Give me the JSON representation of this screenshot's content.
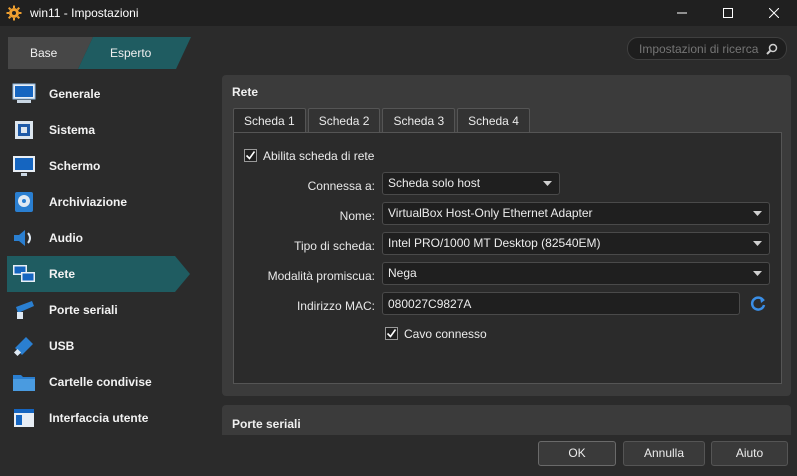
{
  "window": {
    "title": "win11 - Impostazioni",
    "controls": {
      "minimize": "—",
      "maximize": "☐",
      "close": "✕"
    }
  },
  "mode": {
    "base": "Base",
    "expert": "Esperto",
    "selected": "Esperto"
  },
  "search": {
    "placeholder": "Impostazioni di ricerca"
  },
  "sidebar": {
    "items": [
      {
        "label": "Generale",
        "icon": "monitor-general-icon"
      },
      {
        "label": "Sistema",
        "icon": "chip-icon"
      },
      {
        "label": "Schermo",
        "icon": "display-icon"
      },
      {
        "label": "Archiviazione",
        "icon": "disk-icon"
      },
      {
        "label": "Audio",
        "icon": "speaker-icon"
      },
      {
        "label": "Rete",
        "icon": "network-icon"
      },
      {
        "label": "Porte seriali",
        "icon": "serial-port-icon"
      },
      {
        "label": "USB",
        "icon": "usb-icon"
      },
      {
        "label": "Cartelle condivise",
        "icon": "folder-icon"
      },
      {
        "label": "Interfaccia utente",
        "icon": "window-icon"
      }
    ],
    "active": "Rete"
  },
  "network": {
    "section_title": "Rete",
    "tabs": [
      "Scheda 1",
      "Scheda 2",
      "Scheda 3",
      "Scheda 4"
    ],
    "active_tab": "Scheda 1",
    "enable_label": "Abilita scheda di rete",
    "enable_checked": true,
    "attached_label": "Connessa a:",
    "attached_value": "Scheda solo host",
    "name_label": "Nome:",
    "name_value": "VirtualBox Host-Only Ethernet Adapter",
    "adapter_type_label": "Tipo di scheda:",
    "adapter_type_value": "Intel PRO/1000 MT Desktop (82540EM)",
    "promisc_label": "Modalità promiscua:",
    "promisc_value": "Nega",
    "mac_label": "Indirizzo MAC:",
    "mac_value": "080027C9827A",
    "cable_label": "Cavo connesso",
    "cable_checked": true
  },
  "serial": {
    "section_title": "Porte seriali"
  },
  "buttons": {
    "ok": "OK",
    "cancel": "Annulla",
    "help": "Aiuto"
  },
  "colors": {
    "accent": "#1f5c61",
    "background": "#2b2b2b",
    "panel": "#3b3b3b"
  }
}
